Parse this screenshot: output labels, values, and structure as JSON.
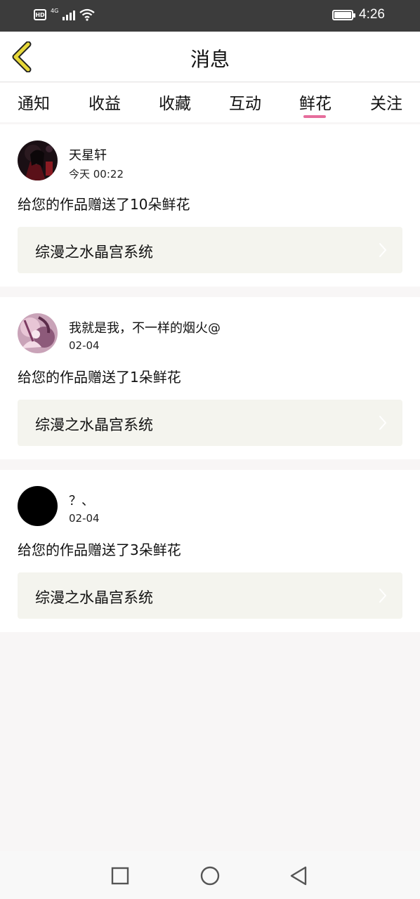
{
  "status_bar": {
    "hd_label": "HD",
    "network_label": "4G",
    "time": "4:26",
    "battery_level": 1.0,
    "icons": [
      "hd-icon",
      "signal-icon",
      "wifi-icon",
      "battery-icon"
    ]
  },
  "header": {
    "title": "消息",
    "back_icon": "chevron-left-icon",
    "accent_color": "#e7d83a"
  },
  "tabs": {
    "items": [
      "通知",
      "收益",
      "收藏",
      "互动",
      "鲜花",
      "关注"
    ],
    "active_index": 4,
    "indicator_color": "#e66d9c"
  },
  "messages": [
    {
      "user_name": "天星轩",
      "time": "今天 00:22",
      "text": "给您的作品赠送了10朵鲜花",
      "work_title": "综漫之水晶宫系统",
      "avatar": "dark-anime-avatar"
    },
    {
      "user_name": "我就是我，不一样的烟火@",
      "time": "02-04",
      "text": "给您的作品赠送了1朵鲜花",
      "work_title": "综漫之水晶宫系统",
      "avatar": "pink-anime-avatar"
    },
    {
      "user_name": "？、",
      "time": "02-04",
      "text": "给您的作品赠送了3朵鲜花",
      "work_title": "综漫之水晶宫系统",
      "avatar": "black-avatar"
    }
  ],
  "nav_bar": {
    "icons": [
      "recent-apps-icon",
      "home-icon",
      "back-triangle-icon"
    ]
  }
}
